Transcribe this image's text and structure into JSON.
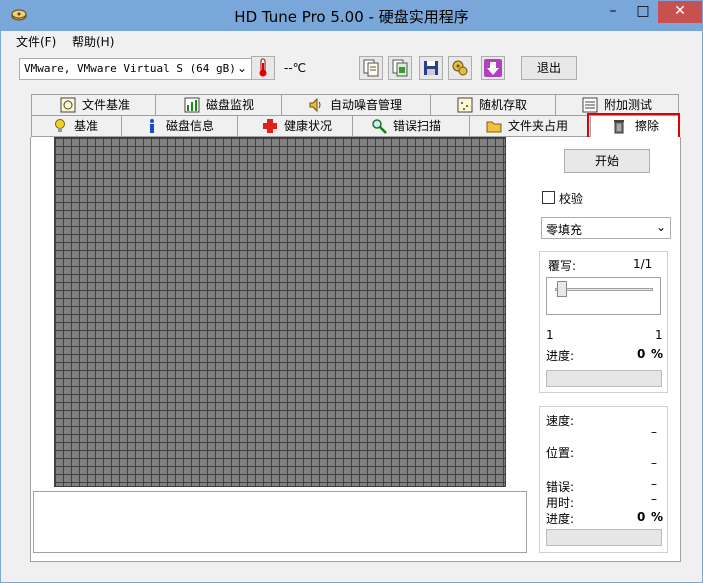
{
  "window": {
    "title": "HD Tune Pro 5.00 - 硬盘实用程序",
    "minimize": "–",
    "maximize": "□",
    "close": "✕"
  },
  "menu": {
    "file": "文件(F)",
    "help": "帮助(H)"
  },
  "toolbar": {
    "drive": "VMware, VMware Virtual S (64 gB)",
    "temperature": "--℃",
    "exit": "退出"
  },
  "tabs": {
    "row1": [
      "文件基准",
      "磁盘监视",
      "自动噪音管理",
      "随机存取",
      "附加测试"
    ],
    "row2": [
      "基准",
      "磁盘信息",
      "健康状况",
      "错误扫描",
      "文件夹占用",
      "擦除"
    ],
    "active": "擦除"
  },
  "controls": {
    "start": "开始",
    "verify_label": "校验",
    "verify_checked": false,
    "fill_mode": "零填充",
    "passes_label": "覆写:",
    "passes_value": "1/1",
    "slider_min": "1",
    "slider_max": "1",
    "progress_label": "进度:",
    "progress_value": "0",
    "progress_unit": "%",
    "progress_fraction": 0
  },
  "stats": {
    "speed_label": "速度:",
    "speed_value": "–",
    "position_label": "位置:",
    "position_value": "–",
    "errors_label": "错误:",
    "errors_value": "–",
    "elapsed_label": "用时:",
    "elapsed_value": "–",
    "progress_label": "进度:",
    "progress_value": "0",
    "progress_unit": "%",
    "progress_fraction": 0
  },
  "colors": {
    "titlebar": "#7aa7d9",
    "close_button": "#c75050",
    "highlight": "#e00000",
    "grid_fill": "#808080"
  }
}
